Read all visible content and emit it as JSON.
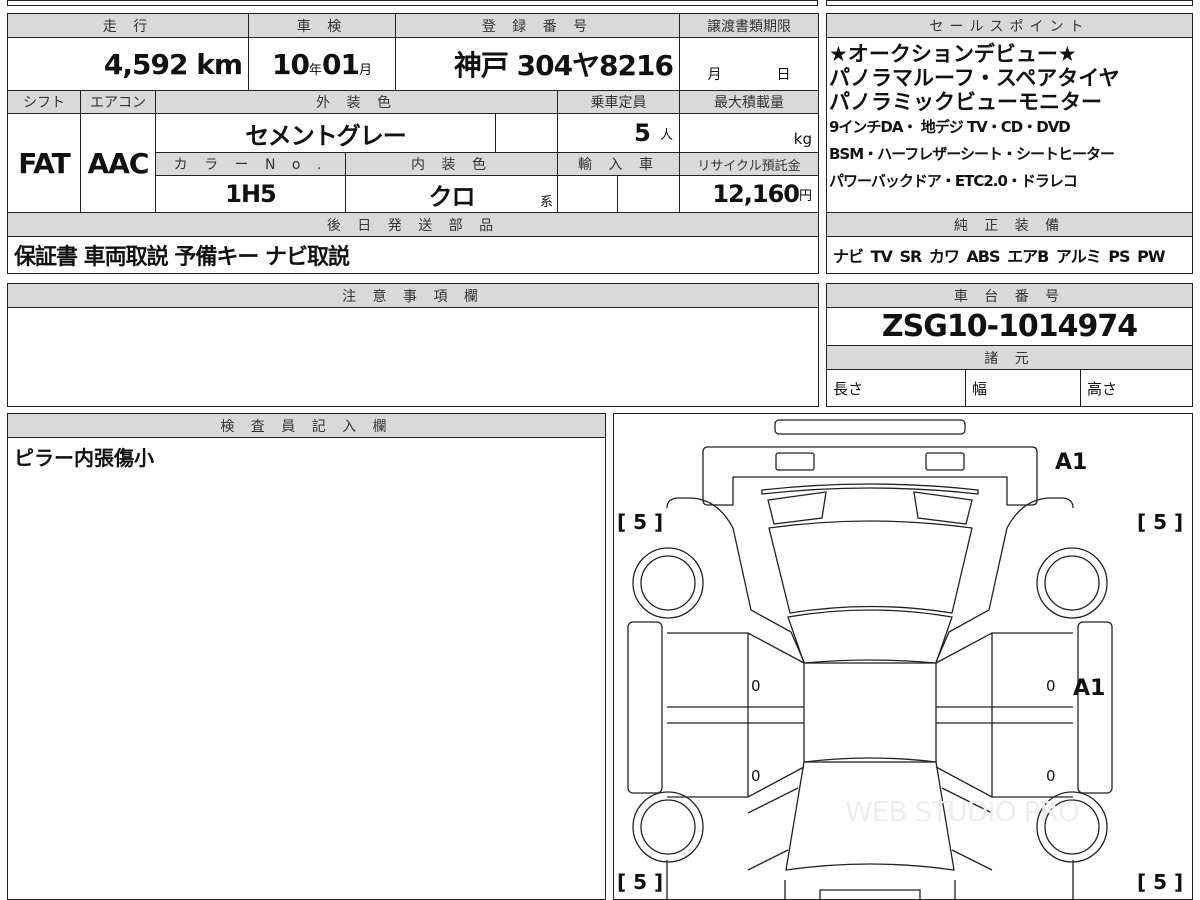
{
  "vehicle": {
    "mileage_label": "走 行",
    "mileage": "4,592",
    "mileage_unit": "km",
    "inspection_label": "車 検",
    "inspection_year": "10",
    "year_unit": "年",
    "inspection_month": "01",
    "month_unit": "月",
    "plate_label": "登 録 番 号",
    "plate": "神戸 304ヤ8216",
    "transfer_label": "譲渡書類期限",
    "transfer_month": "月",
    "transfer_day": "日",
    "shift_label": "シフト",
    "shift": "FAT",
    "ac_label": "エアコン",
    "ac": "AAC",
    "exterior_label": "外 装 色",
    "exterior": "セメントグレー",
    "capacity_label": "乗車定員",
    "capacity": "5",
    "capacity_unit": "人",
    "load_label": "最大積載量",
    "load_unit": "kg",
    "color_no_label": "カ ラ ー N o .",
    "color_no": "1H5",
    "interior_label": "内 装 色",
    "interior": "クロ",
    "interior_suffix": "系",
    "import_label": "輸 入 車",
    "recycle_label": "リサイクル預託金",
    "recycle": "12,160",
    "recycle_unit": "円",
    "parts_label": "後 日 発 送 部 品",
    "parts": "保証書 車両取説 予備キー ナビ取説"
  },
  "sales": {
    "label": "セールスポイント",
    "lines": [
      "★オークションデビュー★",
      "パノラマルーフ・スペアタイヤ",
      "パノラミックビューモニター"
    ],
    "lines_small": [
      "9インチDA・ 地デジ TV・CD・DVD",
      "BSM・ハーフレザーシート・シートヒーター",
      "パワーバックドア・ETC2.0・ドラレコ"
    ]
  },
  "equipment": {
    "label": "純 正 装 備",
    "items": "ナビ TV SR カワ ABS エアB アルミ PS PW"
  },
  "notes": {
    "label": "注 意 事 項 欄"
  },
  "chassis": {
    "label": "車 台 番 号",
    "number": "ZSG10-1014974",
    "spec_label": "諸 元",
    "length": "長さ",
    "width": "幅",
    "height": "高さ"
  },
  "inspector": {
    "label": "検 査 員 記 入 欄",
    "text": "ピラー内張傷小"
  },
  "diagram": {
    "rear_mark": "A1",
    "side_mark": "A1",
    "zero": "0",
    "tire": "[ 5 ]",
    "watermark": "WEB STUDIO PRO"
  }
}
